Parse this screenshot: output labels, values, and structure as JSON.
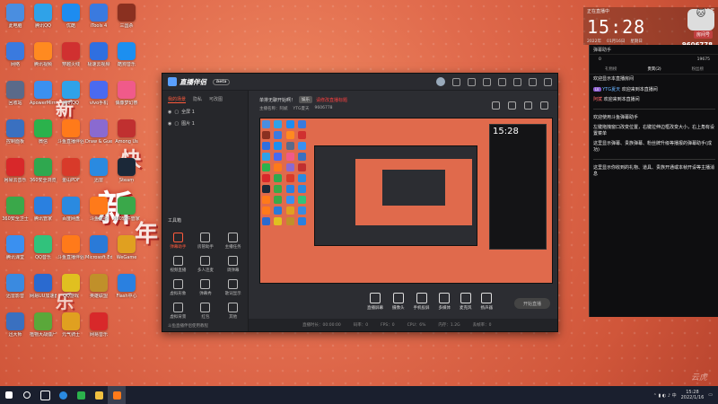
{
  "desktop": {
    "icons": [
      {
        "label": "此电脑",
        "color": "#4a8ee0"
      },
      {
        "label": "腾讯QQ",
        "color": "#2fa2e8"
      },
      {
        "label": "优酷",
        "color": "#1d8cf0"
      },
      {
        "label": "iTools 4",
        "color": "#3a7adf"
      },
      {
        "label": "三国杀",
        "color": "#8a3020"
      },
      {
        "label": "网络",
        "color": "#3a7adf"
      },
      {
        "label": "腾讯视频",
        "color": "#ff8a20"
      },
      {
        "label": "穿越火线",
        "color": "#d03030"
      },
      {
        "label": "极速云视频",
        "color": "#2f6fe0"
      },
      {
        "label": "酷狗音乐",
        "color": "#1c8ff0"
      },
      {
        "label": "回收站",
        "color": "#5a6a8a"
      },
      {
        "label": "ApowerMirror",
        "color": "#3a90f0"
      },
      {
        "label": "腾讯QQ",
        "color": "#2fa2e8"
      },
      {
        "label": "vivo手机",
        "color": "#4a6af0"
      },
      {
        "label": "偶像梦幻祭",
        "color": "#f05a8a"
      },
      {
        "label": "控制面板",
        "color": "#3a70c0"
      },
      {
        "label": "微信",
        "color": "#2bb24c"
      },
      {
        "label": "斗鱼直播伴侣",
        "color": "#ff7a1a"
      },
      {
        "label": "Draw & Guess",
        "color": "#8a6ad0"
      },
      {
        "label": "Among Us",
        "color": "#c03030"
      },
      {
        "label": "网易云音乐",
        "color": "#d8282a"
      },
      {
        "label": "360安全浏览器",
        "color": "#2fa84f"
      },
      {
        "label": "金山PDF",
        "color": "#d83a2a"
      },
      {
        "label": "迅雷",
        "color": "#2a8ae0"
      },
      {
        "label": "Steam",
        "color": "#1b2838"
      },
      {
        "label": "360安全卫士",
        "color": "#3aa84a"
      },
      {
        "label": "腾讯管家",
        "color": "#2a80e0"
      },
      {
        "label": "百度网盘",
        "color": "#2a8ae0"
      },
      {
        "label": "斗鱼直播",
        "color": "#ff7a1a"
      },
      {
        "label": "360软件管家",
        "color": "#3aa84a"
      },
      {
        "label": "腾讯课堂",
        "color": "#3a90f0"
      },
      {
        "label": "QQ音乐",
        "color": "#31c27c"
      },
      {
        "label": "斗鱼直播伴侣",
        "color": "#ff7a1a"
      },
      {
        "label": "Microsoft Edge",
        "color": "#2a7ad8"
      },
      {
        "label": "WeGame",
        "color": "#e0a020"
      },
      {
        "label": "迅雷影音",
        "color": "#3a8ae0"
      },
      {
        "label": "网易UU加速器",
        "color": "#2a6ad0"
      },
      {
        "label": "QQ游戏",
        "color": "#e0c020"
      },
      {
        "label": "英雄联盟",
        "color": "#c0902a"
      },
      {
        "label": "Flash中心",
        "color": "#2a80e0"
      },
      {
        "label": "迅大师",
        "color": "#3a70c0"
      },
      {
        "label": "植物大战僵尸",
        "color": "#5aa83a"
      },
      {
        "label": "元气骑士",
        "color": "#e0a020"
      },
      {
        "label": "网易音乐",
        "color": "#d8282a"
      }
    ],
    "big_chars": [
      "新",
      "年",
      "新",
      "年",
      "快",
      "乐"
    ],
    "signature": "云虎"
  },
  "main_window": {
    "app_name": "直播伴侣",
    "version": "beta",
    "scene_tabs": [
      "我的场景",
      "隐私",
      "可改图"
    ],
    "sources": [
      "全屏 1",
      "图片 1"
    ],
    "room_title": "单排无聊开始啊！",
    "room_tag": "娱乐",
    "room_status": "请修改直播标题",
    "room_info": [
      "主播名称：阿斌",
      "YTG夏天",
      "9606778"
    ],
    "tools_title": "工具箱",
    "tools": [
      "弹幕助手",
      "房管助手",
      "主播任务",
      "视频直播",
      "多人连麦",
      "调弹幕",
      "虚拟形象",
      "弹幕秀",
      "歌词显示",
      "虚拟背景",
      "红包",
      "其他"
    ],
    "notice": "斗鱼直播伴侣使用教程",
    "controls": [
      "直播屏幕",
      "摄像头",
      "手机投屏",
      "多媒体",
      "麦克风",
      "扬声器"
    ],
    "start_button": "开始直播",
    "status_items": [
      "直播时长：00:00:00",
      "码率：0",
      "FPS：0",
      "CPU：6%",
      "内存：1.2G",
      "丢帧率：0"
    ]
  },
  "right_panel": {
    "title": "弹幕助手",
    "stats": [
      "0",
      "19675"
    ],
    "tabs": [
      "礼物榜",
      "贵宾(2)",
      "粉丝榜"
    ],
    "messages": [
      {
        "type": "sys",
        "text": "欢迎显示本直播房间"
      },
      {
        "type": "enter",
        "badge": "LV",
        "name": "YTG夏天",
        "text": "欢迎来到本直播间"
      },
      {
        "type": "enter2",
        "name": "阿斌",
        "text": "欢迎来到本直播间"
      },
      {
        "type": "sys",
        "text": "欢迎使用斗鱼弹幕助手"
      },
      {
        "type": "sys",
        "text": "左键拖拽窗口改变位置，右键拉伸边框改变大小，右上角有设置菜单"
      },
      {
        "type": "sys",
        "text": "这里显示弹幕、贵族弹幕、粉丝牌升级等播报的弹幕助手(成功)"
      },
      {
        "type": "sys2",
        "text": "这里显示你收到的礼物、道具、贵族开通或本帧开设等主播消息"
      }
    ]
  },
  "clock": {
    "top_left": "正在直播中",
    "top_right": "LIVE",
    "time": "15:28",
    "date": [
      "2022年",
      "01月16日",
      "星期日"
    ],
    "room_label": "房间号",
    "room_number": "9606778"
  },
  "taskbar": {
    "time": "15:28",
    "date": "2022/1/16"
  }
}
